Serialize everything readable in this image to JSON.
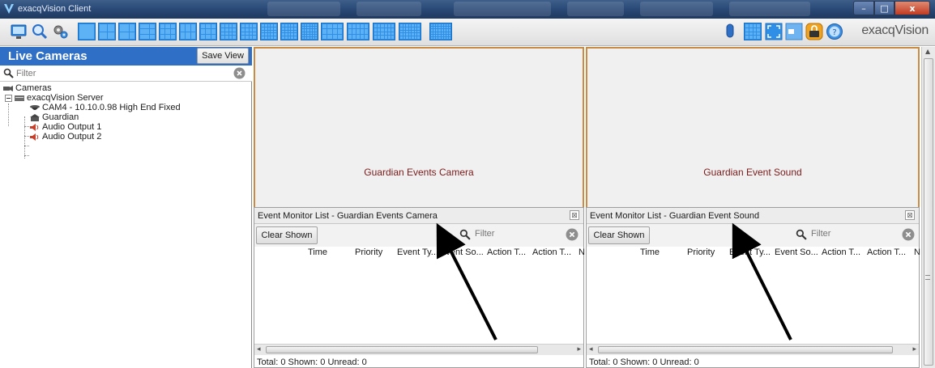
{
  "window": {
    "title": "exacqVision Client",
    "controls": {
      "minimize": "–",
      "maximize": "□",
      "close": "x"
    }
  },
  "toolbar": {
    "brand": "exacqVision",
    "left_icons": [
      "live-view-icon",
      "search-icon",
      "config-icon"
    ],
    "layout_icons": [
      "layout-1x1",
      "layout-2x2",
      "layout-1p5",
      "layout-1p7",
      "layout-3x3",
      "layout-2p8",
      "layout-1p12",
      "layout-4x4",
      "layout-5x5",
      "layout-6x6",
      "layout-7x7",
      "layout-8x8",
      "layout-2x3-wide",
      "layout-3x4",
      "layout-4x5",
      "layout-5x6",
      "layout-6x7"
    ],
    "right_icons": [
      "microphone-icon",
      "matrix-icon",
      "fullscreen-icon",
      "sequence-icon",
      "lock-icon",
      "help-icon"
    ]
  },
  "left_panel": {
    "title": "Live Cameras",
    "save_view": "Save View",
    "filter_placeholder": "Filter",
    "tree": {
      "root": "Cameras",
      "server": "exacqVision Server",
      "items": [
        {
          "label": "CAM4 - 10.10.0.98 High End Fixed",
          "icon": "camera-icon"
        },
        {
          "label": "Guardian",
          "icon": "guardian-icon"
        },
        {
          "label": "Audio Output 1",
          "icon": "speaker-icon"
        },
        {
          "label": "Audio Output 2",
          "icon": "speaker-icon"
        }
      ]
    }
  },
  "panes": [
    {
      "label": "Guardian Events Camera",
      "monitor_title": "Event Monitor List - Guardian Events Camera",
      "clear": "Clear Shown",
      "filter_placeholder": "Filter",
      "columns": [
        "Time",
        "Priority",
        "Event Ty...",
        "Event So...",
        "Action T...",
        "Action T...",
        "N"
      ],
      "status": "Total: 0 Shown: 0 Unread: 0"
    },
    {
      "label": "Guardian Event Sound",
      "monitor_title": "Event Monitor List - Guardian Event Sound",
      "clear": "Clear Shown",
      "filter_placeholder": "Filter",
      "columns": [
        "Time",
        "Priority",
        "Event Ty...",
        "Event So...",
        "Action T...",
        "Action T...",
        "N"
      ],
      "status": "Total: 0 Shown: 0 Unread: 0"
    }
  ],
  "scrollbar": {
    "thumb_offset_fraction": 0.0
  },
  "colors": {
    "header_blue": "#2f6fc6",
    "pane_border": "#c98a43",
    "pane_label": "#7a1b1b",
    "layout_icon": "#2f8fe6"
  }
}
